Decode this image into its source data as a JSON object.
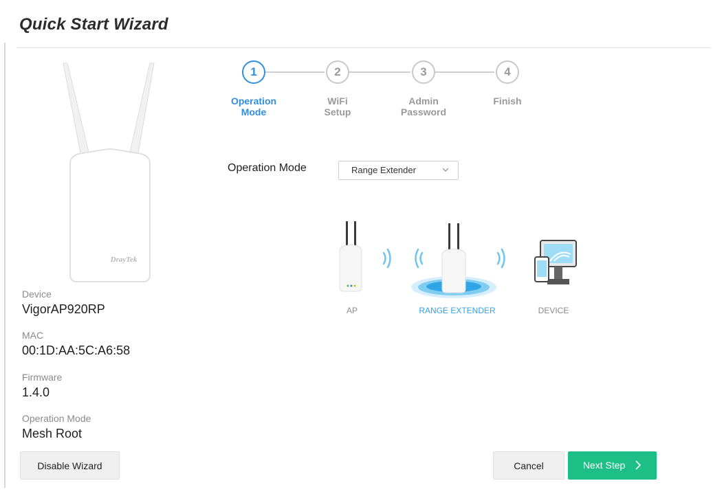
{
  "title": "Quick Start Wizard",
  "device_logo": "DrayTek",
  "info": {
    "device_label": "Device",
    "device_value": "VigorAP920RP",
    "mac_label": "MAC",
    "mac_value": "00:1D:AA:5C:A6:58",
    "firmware_label": "Firmware",
    "firmware_value": "1.4.0",
    "opmode_label": "Operation Mode",
    "opmode_value": "Mesh Root"
  },
  "steps": [
    {
      "number": "1",
      "label_line1": "Operation",
      "label_line2": "Mode",
      "active": true
    },
    {
      "number": "2",
      "label_line1": "WiFi",
      "label_line2": "Setup",
      "active": false
    },
    {
      "number": "3",
      "label_line1": "Admin",
      "label_line2": "Password",
      "active": false
    },
    {
      "number": "4",
      "label_line1": "Finish",
      "label_line2": "",
      "active": false
    }
  ],
  "operation_mode": {
    "label": "Operation Mode",
    "selected": "Range Extender"
  },
  "diagram": {
    "ap_caption": "AP",
    "extender_caption": "RANGE EXTENDER",
    "device_caption": "DEVICE"
  },
  "buttons": {
    "disable_wizard": "Disable Wizard",
    "cancel": "Cancel",
    "next_step": "Next Step"
  },
  "colors": {
    "accent_blue": "#2f8fdc",
    "next_green": "#1dbf86",
    "inactive_gray": "#9a9a9a",
    "wifi_wave_blue": "#6cc6ea"
  }
}
